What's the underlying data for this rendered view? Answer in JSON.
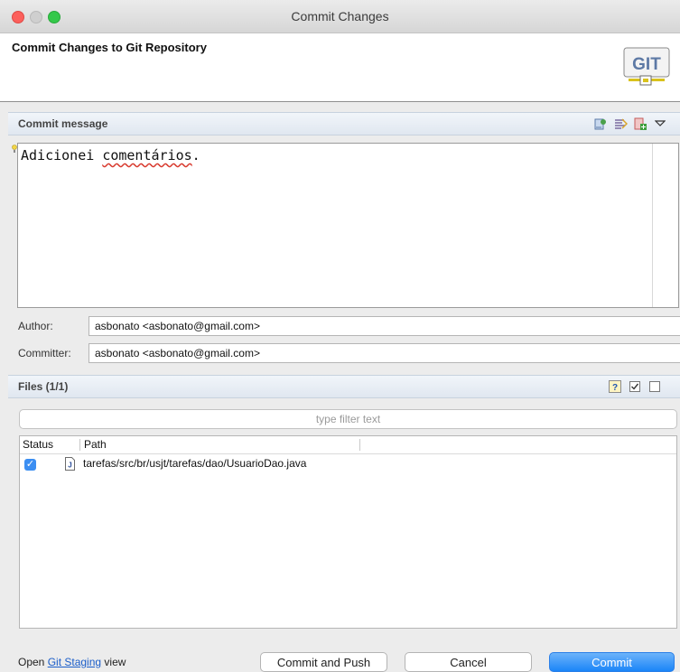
{
  "window": {
    "title": "Commit Changes"
  },
  "header": {
    "title": "Commit Changes to Git Repository",
    "logo_text": "GIT"
  },
  "commit_message": {
    "section_title": "Commit message",
    "text_prefix": "Adicionei ",
    "text_misspelled": "comentários",
    "text_suffix": ".",
    "toolbar_icons": [
      "add-signed-off-icon",
      "format-message-icon",
      "add-change-id-icon",
      "view-menu-icon"
    ]
  },
  "author": {
    "label": "Author:",
    "value": "asbonato <asbonato@gmail.com>"
  },
  "committer": {
    "label": "Committer:",
    "value": "asbonato <asbonato@gmail.com>"
  },
  "files": {
    "section_title": "Files (1/1)",
    "filter_placeholder": "type filter text",
    "columns": [
      "Status",
      "Path"
    ],
    "rows": [
      {
        "checked": true,
        "path": "tarefas/src/br/usjt/tarefas/dao/UsuarioDao.java",
        "icon": "java-file-icon"
      }
    ]
  },
  "footer": {
    "open_prefix": "Open",
    "link": "Git Staging",
    "open_suffix": "view",
    "commit_and_push": "Commit and Push",
    "cancel": "Cancel",
    "commit": "Commit"
  },
  "colors": {
    "accent": "#1b85f8",
    "section_bar": "#e0e7f0",
    "link": "#1a5dc9"
  }
}
